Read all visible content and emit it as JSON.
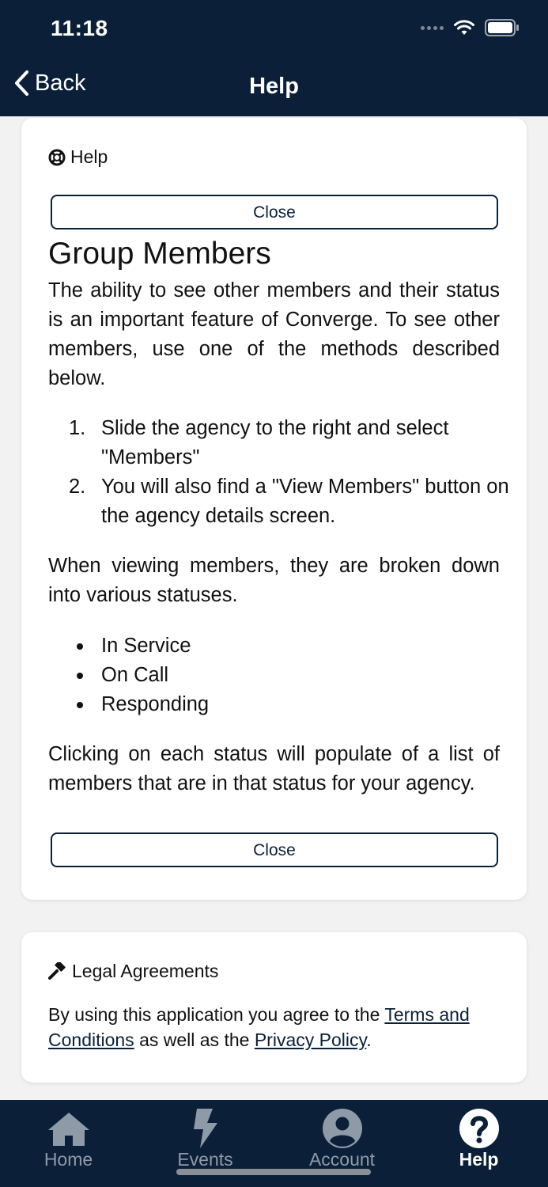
{
  "status_bar": {
    "time": "11:18"
  },
  "nav": {
    "back_label": "Back",
    "title": "Help"
  },
  "help_card": {
    "section_label": "Help",
    "close_label": "Close",
    "heading": "Group Members",
    "intro": "The ability to see other members and their status is an important feature of Converge. To see other members, use one of the methods described below.",
    "steps": [
      {
        "num": "1.",
        "text": "Slide the agency to the right and select \"Members\""
      },
      {
        "num": "2.",
        "text": "You will also find a \"View Members\" button on the agency details screen."
      }
    ],
    "statuses_intro": "When viewing members, they are broken down into various statuses.",
    "statuses": [
      "In Service",
      "On Call",
      "Responding"
    ],
    "outro": "Clicking on each status will populate of a list of members that are in that status for your agency."
  },
  "legal_card": {
    "section_label": "Legal Agreements",
    "text_before": "By using this application you agree to the ",
    "terms_link": "Terms and Conditions",
    "text_middle": " as well as the ",
    "privacy_link": "Privacy Policy",
    "text_after": "."
  },
  "tabbar": {
    "tabs": [
      {
        "label": "Home",
        "icon": "home-icon"
      },
      {
        "label": "Events",
        "icon": "lightning-icon"
      },
      {
        "label": "Account",
        "icon": "user-circle-icon"
      },
      {
        "label": "Help",
        "icon": "question-circle-icon"
      }
    ],
    "active": "Help"
  },
  "colors": {
    "navy": "#0b2038",
    "inactive_tab": "#8f9aa8",
    "background": "#f2f2f2"
  }
}
